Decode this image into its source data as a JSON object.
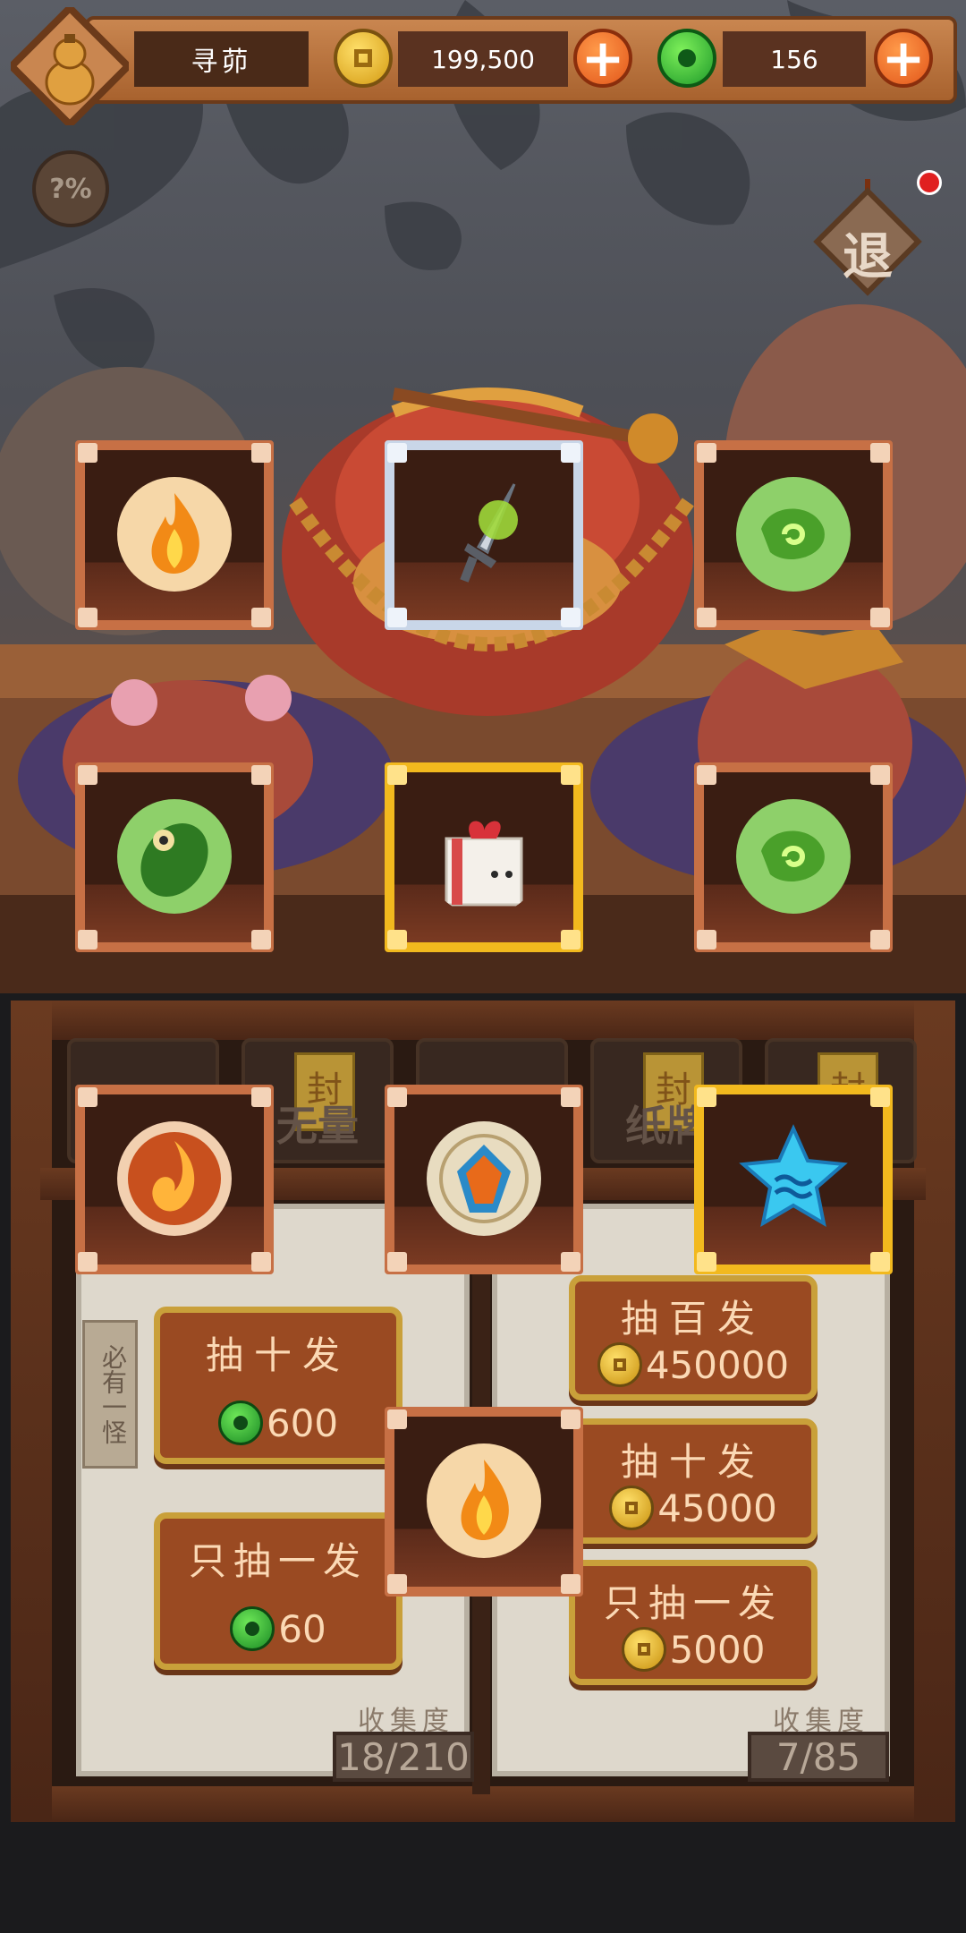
{
  "header": {
    "player_name": "寻茆",
    "coins": "199,500",
    "jade": "156",
    "exit_label": "退"
  },
  "help_button": {
    "label": "?%"
  },
  "top_items": [
    {
      "icon": "fire-orb-icon",
      "frame": "bronze"
    },
    {
      "icon": "green-dagger-icon",
      "frame": "silver"
    },
    {
      "icon": "green-swirl-orb-icon",
      "frame": "bronze"
    },
    {
      "icon": "green-leaf-creature-orb-icon",
      "frame": "bronze"
    },
    {
      "icon": "gift-box-icon",
      "frame": "gold"
    },
    {
      "icon": "green-swirl-orb-icon",
      "frame": "bronze"
    }
  ],
  "cabinet_tabs": [
    {
      "label": "",
      "seal": ""
    },
    {
      "label": "无量",
      "seal": "封"
    },
    {
      "label": "",
      "seal": ""
    },
    {
      "label": "纸牌",
      "seal": "封"
    },
    {
      "label": "",
      "seal": "封"
    }
  ],
  "overlay_items": [
    {
      "icon": "fire-swirl-orb-icon",
      "frame": "bronze"
    },
    {
      "icon": "amber-gem-orb-icon",
      "frame": "bronze"
    },
    {
      "icon": "blue-star-icon",
      "frame": "gold"
    },
    {
      "icon": "fire-orb-icon",
      "frame": "bronze"
    }
  ],
  "left_panel": {
    "side_tag": "必有一怪",
    "draw_ten": {
      "label": "抽十发",
      "cost": "600",
      "currency": "jade"
    },
    "draw_one": {
      "label": "只抽一发",
      "cost": "60",
      "currency": "jade"
    },
    "collection_label": "收集度",
    "collection_value": "18/210"
  },
  "right_panel": {
    "draw_hundred": {
      "label": "抽百发",
      "cost": "450000",
      "currency": "gold"
    },
    "draw_ten": {
      "label": "抽十发",
      "cost": "45000",
      "currency": "gold"
    },
    "draw_one": {
      "label": "只抽一发",
      "cost": "5000",
      "currency": "gold"
    },
    "collection_label": "收集度",
    "collection_value": "7/85"
  },
  "colors": {
    "bronze_frame": "#c77045",
    "silver_frame": "#c9d6e8",
    "gold_frame": "#f2b91e",
    "button_fill": "#9a4a22",
    "plus_button": "#e2561a"
  }
}
